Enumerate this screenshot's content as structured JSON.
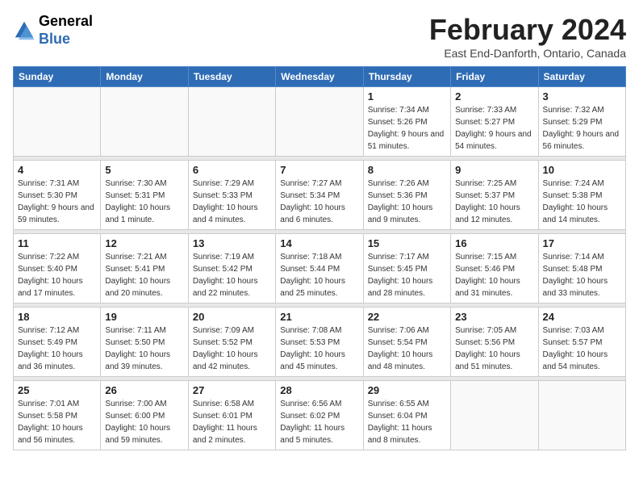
{
  "header": {
    "logo": {
      "general": "General",
      "blue": "Blue"
    },
    "month_year": "February 2024",
    "location": "East End-Danforth, Ontario, Canada"
  },
  "days_of_week": [
    "Sunday",
    "Monday",
    "Tuesday",
    "Wednesday",
    "Thursday",
    "Friday",
    "Saturday"
  ],
  "weeks": [
    {
      "days": [
        {
          "num": "",
          "empty": true
        },
        {
          "num": "",
          "empty": true
        },
        {
          "num": "",
          "empty": true
        },
        {
          "num": "",
          "empty": true
        },
        {
          "num": "1",
          "sunrise": "7:34 AM",
          "sunset": "5:26 PM",
          "daylight": "9 hours and 51 minutes."
        },
        {
          "num": "2",
          "sunrise": "7:33 AM",
          "sunset": "5:27 PM",
          "daylight": "9 hours and 54 minutes."
        },
        {
          "num": "3",
          "sunrise": "7:32 AM",
          "sunset": "5:29 PM",
          "daylight": "9 hours and 56 minutes."
        }
      ]
    },
    {
      "days": [
        {
          "num": "4",
          "sunrise": "7:31 AM",
          "sunset": "5:30 PM",
          "daylight": "9 hours and 59 minutes."
        },
        {
          "num": "5",
          "sunrise": "7:30 AM",
          "sunset": "5:31 PM",
          "daylight": "10 hours and 1 minute."
        },
        {
          "num": "6",
          "sunrise": "7:29 AM",
          "sunset": "5:33 PM",
          "daylight": "10 hours and 4 minutes."
        },
        {
          "num": "7",
          "sunrise": "7:27 AM",
          "sunset": "5:34 PM",
          "daylight": "10 hours and 6 minutes."
        },
        {
          "num": "8",
          "sunrise": "7:26 AM",
          "sunset": "5:36 PM",
          "daylight": "10 hours and 9 minutes."
        },
        {
          "num": "9",
          "sunrise": "7:25 AM",
          "sunset": "5:37 PM",
          "daylight": "10 hours and 12 minutes."
        },
        {
          "num": "10",
          "sunrise": "7:24 AM",
          "sunset": "5:38 PM",
          "daylight": "10 hours and 14 minutes."
        }
      ]
    },
    {
      "days": [
        {
          "num": "11",
          "sunrise": "7:22 AM",
          "sunset": "5:40 PM",
          "daylight": "10 hours and 17 minutes."
        },
        {
          "num": "12",
          "sunrise": "7:21 AM",
          "sunset": "5:41 PM",
          "daylight": "10 hours and 20 minutes."
        },
        {
          "num": "13",
          "sunrise": "7:19 AM",
          "sunset": "5:42 PM",
          "daylight": "10 hours and 22 minutes."
        },
        {
          "num": "14",
          "sunrise": "7:18 AM",
          "sunset": "5:44 PM",
          "daylight": "10 hours and 25 minutes."
        },
        {
          "num": "15",
          "sunrise": "7:17 AM",
          "sunset": "5:45 PM",
          "daylight": "10 hours and 28 minutes."
        },
        {
          "num": "16",
          "sunrise": "7:15 AM",
          "sunset": "5:46 PM",
          "daylight": "10 hours and 31 minutes."
        },
        {
          "num": "17",
          "sunrise": "7:14 AM",
          "sunset": "5:48 PM",
          "daylight": "10 hours and 33 minutes."
        }
      ]
    },
    {
      "days": [
        {
          "num": "18",
          "sunrise": "7:12 AM",
          "sunset": "5:49 PM",
          "daylight": "10 hours and 36 minutes."
        },
        {
          "num": "19",
          "sunrise": "7:11 AM",
          "sunset": "5:50 PM",
          "daylight": "10 hours and 39 minutes."
        },
        {
          "num": "20",
          "sunrise": "7:09 AM",
          "sunset": "5:52 PM",
          "daylight": "10 hours and 42 minutes."
        },
        {
          "num": "21",
          "sunrise": "7:08 AM",
          "sunset": "5:53 PM",
          "daylight": "10 hours and 45 minutes."
        },
        {
          "num": "22",
          "sunrise": "7:06 AM",
          "sunset": "5:54 PM",
          "daylight": "10 hours and 48 minutes."
        },
        {
          "num": "23",
          "sunrise": "7:05 AM",
          "sunset": "5:56 PM",
          "daylight": "10 hours and 51 minutes."
        },
        {
          "num": "24",
          "sunrise": "7:03 AM",
          "sunset": "5:57 PM",
          "daylight": "10 hours and 54 minutes."
        }
      ]
    },
    {
      "days": [
        {
          "num": "25",
          "sunrise": "7:01 AM",
          "sunset": "5:58 PM",
          "daylight": "10 hours and 56 minutes."
        },
        {
          "num": "26",
          "sunrise": "7:00 AM",
          "sunset": "6:00 PM",
          "daylight": "10 hours and 59 minutes."
        },
        {
          "num": "27",
          "sunrise": "6:58 AM",
          "sunset": "6:01 PM",
          "daylight": "11 hours and 2 minutes."
        },
        {
          "num": "28",
          "sunrise": "6:56 AM",
          "sunset": "6:02 PM",
          "daylight": "11 hours and 5 minutes."
        },
        {
          "num": "29",
          "sunrise": "6:55 AM",
          "sunset": "6:04 PM",
          "daylight": "11 hours and 8 minutes."
        },
        {
          "num": "",
          "empty": true
        },
        {
          "num": "",
          "empty": true
        }
      ]
    }
  ],
  "labels": {
    "sunrise": "Sunrise:",
    "sunset": "Sunset:",
    "daylight": "Daylight:"
  },
  "colors": {
    "header_bg": "#2e6cb5",
    "accent": "#2e6cb5"
  }
}
